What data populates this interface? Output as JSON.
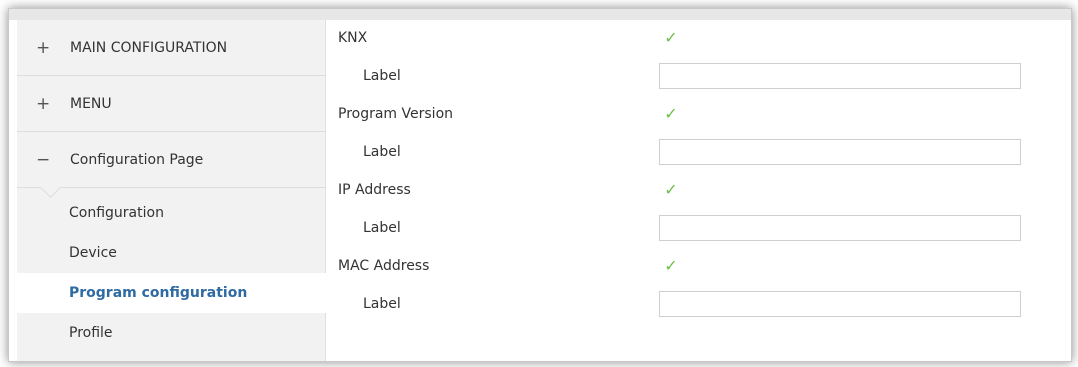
{
  "sidebar": {
    "sections": [
      {
        "symbol": "+",
        "label": "MAIN CONFIGURATION"
      },
      {
        "symbol": "+",
        "label": "MENU"
      },
      {
        "symbol": "−",
        "label": "Configuration Page"
      }
    ],
    "subitems": [
      {
        "label": "Configuration"
      },
      {
        "label": "Device"
      },
      {
        "label": "Program configuration"
      },
      {
        "label": "Profile"
      }
    ]
  },
  "params": {
    "knx": {
      "label": "KNX",
      "checkmark": "✓"
    },
    "knx_label": {
      "label": "Label",
      "value": ""
    },
    "program_version": {
      "label": "Program Version",
      "checkmark": "✓"
    },
    "program_version_label": {
      "label": "Label",
      "value": ""
    },
    "ip_address": {
      "label": "IP Address",
      "checkmark": "✓"
    },
    "ip_address_label": {
      "label": "Label",
      "value": ""
    },
    "mac_address": {
      "label": "MAC Address",
      "checkmark": "✓"
    },
    "mac_address_label": {
      "label": "Label",
      "value": ""
    }
  },
  "colors": {
    "active_item": "#2f6aa3",
    "checkmark": "#6cbf4a",
    "sidebar_bg": "#f2f2f2"
  }
}
